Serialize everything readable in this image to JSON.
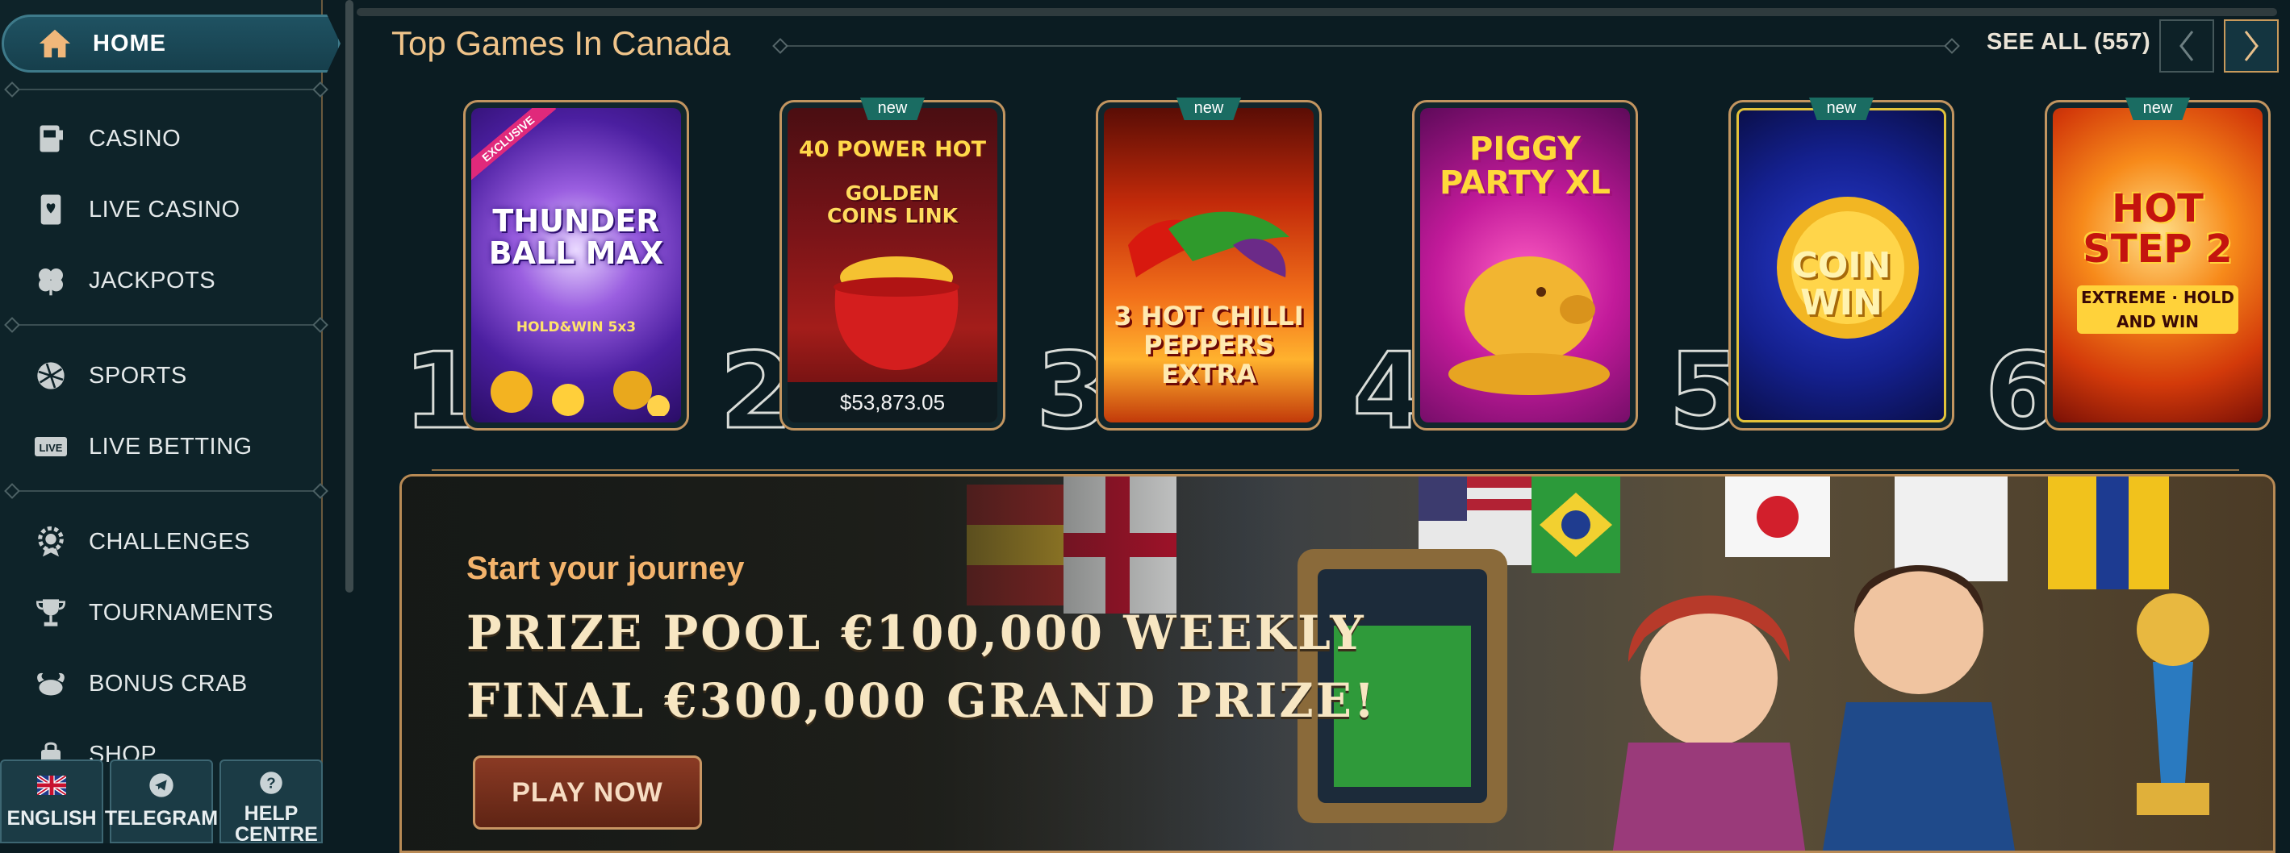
{
  "sidebar": {
    "home": {
      "label": "HOME",
      "icon": "home-icon"
    },
    "items": [
      {
        "id": "casino",
        "label": "CASINO",
        "icon": "slot-machine-icon"
      },
      {
        "id": "live-casino",
        "label": "LIVE CASINO",
        "icon": "card-icon"
      },
      {
        "id": "jackpots",
        "label": "JACKPOTS",
        "icon": "clover-icon"
      },
      {
        "id": "sports",
        "label": "SPORTS",
        "icon": "ball-icon"
      },
      {
        "id": "live-betting",
        "label": "LIVE BETTING",
        "icon": "live-icon",
        "badge": "LIVE"
      },
      {
        "id": "challenges",
        "label": "CHALLENGES",
        "icon": "gear-badge-icon"
      },
      {
        "id": "tournaments",
        "label": "TOURNAMENTS",
        "icon": "trophy-icon"
      },
      {
        "id": "bonus-crab",
        "label": "BONUS CRAB",
        "icon": "crab-icon"
      },
      {
        "id": "shop",
        "label": "SHOP",
        "icon": "bag-icon"
      }
    ]
  },
  "bottom_bar": {
    "language": "ENGLISH",
    "telegram": "TELEGRAM",
    "help": "HELP CENTRE"
  },
  "top_games": {
    "title": "Top Games In Canada",
    "see_all": "SEE ALL (557)",
    "games": [
      {
        "rank": "1",
        "name": "THUNDER BALL MAX",
        "subtitle": "HOLD&WIN 5x3",
        "badge": "EXCLUSIVE",
        "new": ""
      },
      {
        "rank": "2",
        "name": "40 POWER HOT",
        "subtitle": "GOLDEN COINS LINK",
        "new": "new",
        "jackpot": "$53,873.05"
      },
      {
        "rank": "3",
        "name": "3 HOT CHILLI PEPPERS EXTRA",
        "subtitle": "",
        "new": "new"
      },
      {
        "rank": "4",
        "name": "PIGGY PARTY XL",
        "subtitle": "",
        "new": ""
      },
      {
        "rank": "5",
        "name": "COIN WIN",
        "subtitle": "",
        "new": "new"
      },
      {
        "rank": "6",
        "name": "HOT STEP 2",
        "subtitle": "EXTREME · HOLD AND WIN",
        "new": "new"
      }
    ]
  },
  "banner": {
    "subtitle": "Start your journey",
    "headline_1": "PRIZE POOL €100,000 WEEKLY",
    "headline_2": "FINAL €300,000 GRAND PRIZE!",
    "cta": "PLAY NOW"
  },
  "colors": {
    "background": "#0b1c22",
    "accent_gold": "#c29560",
    "title_orange": "#f0c48a",
    "new_tag": "#1a6c62"
  }
}
